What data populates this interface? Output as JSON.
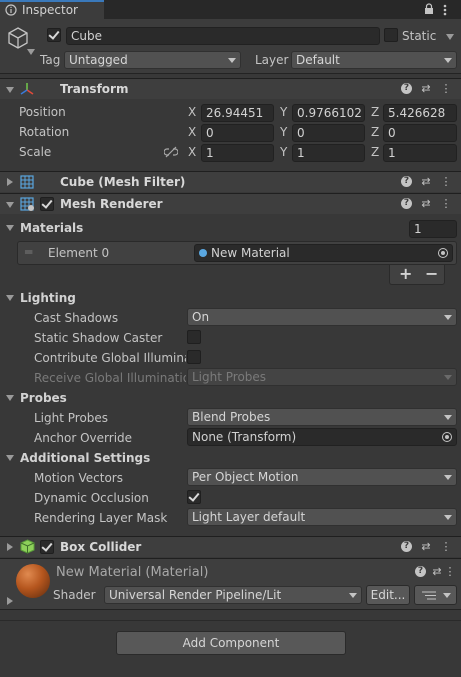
{
  "tab": {
    "title": "Inspector"
  },
  "header": {
    "active": true,
    "name": "Cube",
    "static_label": "Static",
    "tag_label": "Tag",
    "tag_value": "Untagged",
    "layer_label": "Layer",
    "layer_value": "Default"
  },
  "transform": {
    "title": "Transform",
    "rows": [
      {
        "label": "Position",
        "x": "26.94451",
        "y": "0.9766102",
        "z": "5.426628"
      },
      {
        "label": "Rotation",
        "x": "0",
        "y": "0",
        "z": "0"
      },
      {
        "label": "Scale",
        "x": "1",
        "y": "1",
        "z": "1"
      }
    ],
    "axis": {
      "x": "X",
      "y": "Y",
      "z": "Z"
    }
  },
  "mesh_filter": {
    "title": "Cube (Mesh Filter)"
  },
  "mesh_renderer": {
    "title": "Mesh Renderer",
    "materials_label": "Materials",
    "materials_count": "1",
    "element_label": "Element 0",
    "element_value": "New Material",
    "add": "+",
    "remove": "−",
    "lighting": {
      "title": "Lighting",
      "cast_shadows_label": "Cast Shadows",
      "cast_shadows_value": "On",
      "static_shadow_label": "Static Shadow Caster",
      "contribute_gi_label": "Contribute Global Illuminati",
      "receive_gi_label": "Receive Global Illumination",
      "receive_gi_value": "Light Probes"
    },
    "probes": {
      "title": "Probes",
      "light_probes_label": "Light Probes",
      "light_probes_value": "Blend Probes",
      "anchor_label": "Anchor Override",
      "anchor_value": "None (Transform)"
    },
    "additional": {
      "title": "Additional Settings",
      "motion_vectors_label": "Motion Vectors",
      "motion_vectors_value": "Per Object Motion",
      "dynamic_occlusion_label": "Dynamic Occlusion",
      "rendering_layer_label": "Rendering Layer Mask",
      "rendering_layer_value": "Light Layer default"
    }
  },
  "box_collider": {
    "title": "Box Collider"
  },
  "material": {
    "title": "New Material (Material)",
    "shader_label": "Shader",
    "shader_value": "Universal Render Pipeline/Lit",
    "edit_label": "Edit..."
  },
  "add_component": "Add Component",
  "colors": {
    "accent": "#3a79bb",
    "panel": "#383838",
    "header": "#3e3e3e",
    "field": "#2a2a2a"
  }
}
